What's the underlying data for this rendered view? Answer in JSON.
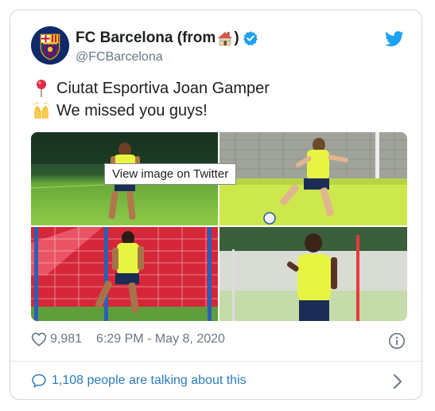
{
  "account": {
    "display_name": "FC Barcelona (from",
    "closing_paren": ")",
    "handle": "@FCBarcelona",
    "avatar_icon": "fc-barcelona-crest",
    "brand_color": "#1da1f2"
  },
  "tweet": {
    "line1": "Ciutat Esportiva Joan Gamper",
    "line2": "We missed you guys!",
    "line1_icon": "round-pushpin-emoji",
    "line2_icon": "raising-hands-emoji"
  },
  "media": {
    "tooltip": "View image on Twitter",
    "photos": [
      "training-photo-1",
      "training-photo-2",
      "training-photo-3",
      "training-photo-4"
    ]
  },
  "meta": {
    "likes": "9,981",
    "timestamp": "6:29 PM - May 8, 2020"
  },
  "footer": {
    "talking": "1,108 people are talking about this"
  },
  "colors": {
    "link": "#2b7bb9",
    "muted": "#697882",
    "verified": "#1da1f2"
  }
}
